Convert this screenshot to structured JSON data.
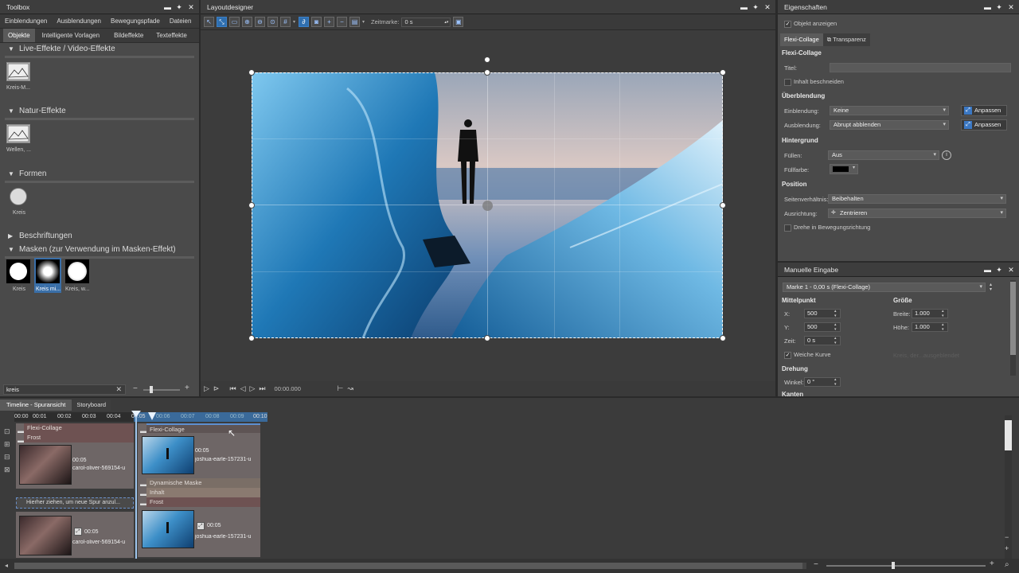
{
  "toolbox": {
    "title": "Toolbox",
    "tabs_row1": [
      "Einblendungen",
      "Ausblendungen",
      "Bewegungspfade",
      "Dateien"
    ],
    "tabs_row2": [
      "Objekte",
      "Intelligente Vorlagen",
      "Bildeffekte",
      "Texteffekte"
    ],
    "sections": {
      "live": "Live-Effekte / Video-Effekte",
      "natur": "Natur-Effekte",
      "formen": "Formen",
      "beschriftungen": "Beschriftungen",
      "masken": "Masken (zur Verwendung im Masken-Effekt)"
    },
    "items": {
      "live_item": "Kreis-M...",
      "natur_item": "Wellen, ...",
      "formen_item": "Kreis",
      "mask1": "Kreis",
      "mask2": "Kreis mi...",
      "mask3": "Kreis, w..."
    },
    "search_value": "kreis"
  },
  "layoutdesigner": {
    "title": "Layoutdesigner",
    "zeitmarke_label": "Zeitmarke:",
    "zeitmarke_value": "0 s",
    "time_display": "00:00.000"
  },
  "properties": {
    "title": "Eigenschaften",
    "show_object": "Objekt anzeigen",
    "tab_flexi": "Flexi-Collage",
    "tab_transparenz": "Transparenz",
    "section_flexi": "Flexi-Collage",
    "titel_label": "Titel:",
    "inhalt_beschneiden": "Inhalt beschneiden",
    "section_ueberblendung": "Überblendung",
    "einblendung_label": "Einblendung:",
    "einblendung_value": "Keine",
    "ausblendung_label": "Ausblendung:",
    "ausblendung_value": "Abrupt abblenden",
    "anpassen": "Anpassen",
    "section_hintergrund": "Hintergrund",
    "fuellen_label": "Füllen:",
    "fuellen_value": "Aus",
    "fuellfarbe_label": "Füllfarbe:",
    "section_position": "Position",
    "seitenverhaeltnis_label": "Seitenverhältnis:",
    "seitenverhaeltnis_value": "Beibehalten",
    "ausrichtung_label": "Ausrichtung:",
    "ausrichtung_value": "Zentrieren",
    "drehe": "Drehe in Bewegungsrichtung"
  },
  "manual": {
    "title": "Manuelle Eingabe",
    "marker": "Marke 1 - 0,00 s (Flexi-Collage)",
    "mittelpunkt": "Mittelpunkt",
    "groesse": "Größe",
    "x_label": "X:",
    "x_value": "500",
    "y_label": "Y:",
    "y_value": "500",
    "zeit_label": "Zeit:",
    "zeit_value": "0 s",
    "breite_label": "Breite:",
    "breite_value": "1.000",
    "hoehe_label": "Höhe:",
    "hoehe_value": "1.000",
    "weiche_kurve": "Weiche Kurve",
    "drehung": "Drehung",
    "winkel_label": "Winkel:",
    "winkel_value": "0 °",
    "kanten": "Kanten",
    "faded": "Kreis, der...ausgeblendet"
  },
  "timeline": {
    "tab_timeline": "Timeline - Spuransicht",
    "tab_storyboard": "Storyboard",
    "ruler": [
      "00:00",
      "00:01",
      "00:02",
      "00:03",
      "00:04",
      "00:05",
      "00:06",
      "00:07",
      "00:08",
      "00:09",
      "00:10"
    ],
    "left_track": {
      "label1": "Flexi-Collage",
      "label2": "Frost",
      "duration": "00:05",
      "file": "carol-oliver-569154-u",
      "hint": "Hierher ziehen, um neue Spur anzul...",
      "duration2": "00:05",
      "file2": "carol-oliver-569154-u"
    },
    "right_track": {
      "label1": "Flexi-Collage",
      "duration": "00:05",
      "file": "joshua-earle-157231-u",
      "label2": "Dynamische Maske",
      "label3": "Inhalt",
      "label4": "Frost",
      "duration2": "00:05",
      "file2": "joshua-earle-157231-u"
    }
  }
}
